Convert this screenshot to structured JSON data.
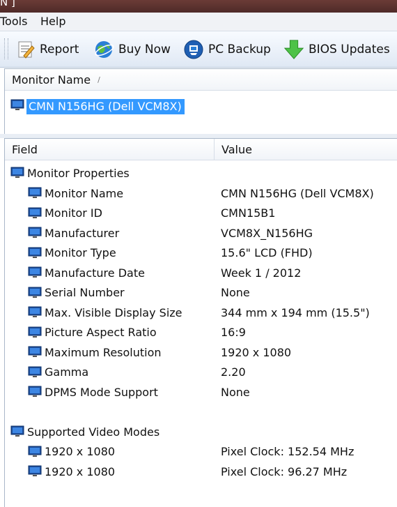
{
  "window": {
    "title_fragment": "N ]"
  },
  "menu": [
    "Tools",
    "Help"
  ],
  "toolbar": {
    "report": "Report",
    "buy_now": "Buy Now",
    "pc_backup": "PC Backup",
    "bios_updates": "BIOS Updates"
  },
  "monitor_list": {
    "header": "Monitor Name",
    "selected": "CMN N156HG (Dell VCM8X)"
  },
  "details": {
    "header_field": "Field",
    "header_value": "Value",
    "groups": [
      {
        "label": "Monitor Properties",
        "rows": [
          {
            "field": "Monitor Name",
            "value": "CMN N156HG (Dell VCM8X)"
          },
          {
            "field": "Monitor ID",
            "value": "CMN15B1"
          },
          {
            "field": "Manufacturer",
            "value": "VCM8X_N156HG"
          },
          {
            "field": "Monitor Type",
            "value": "15.6\" LCD (FHD)"
          },
          {
            "field": "Manufacture Date",
            "value": "Week 1 / 2012"
          },
          {
            "field": "Serial Number",
            "value": "None"
          },
          {
            "field": "Max. Visible Display Size",
            "value": "344 mm x 194 mm (15.5\")"
          },
          {
            "field": "Picture Aspect Ratio",
            "value": "16:9"
          },
          {
            "field": "Maximum Resolution",
            "value": "1920 x 1080"
          },
          {
            "field": "Gamma",
            "value": "2.20"
          },
          {
            "field": "DPMS Mode Support",
            "value": "None"
          }
        ]
      },
      {
        "label": "Supported Video Modes",
        "rows": [
          {
            "field": "1920 x 1080",
            "value": "Pixel Clock: 152.54 MHz"
          },
          {
            "field": "1920 x 1080",
            "value": "Pixel Clock: 96.27 MHz"
          }
        ]
      }
    ]
  },
  "colors": {
    "selection": "#3399ff",
    "toolbar_top": "#f8fbff",
    "toolbar_bottom": "#dfe8f4"
  }
}
